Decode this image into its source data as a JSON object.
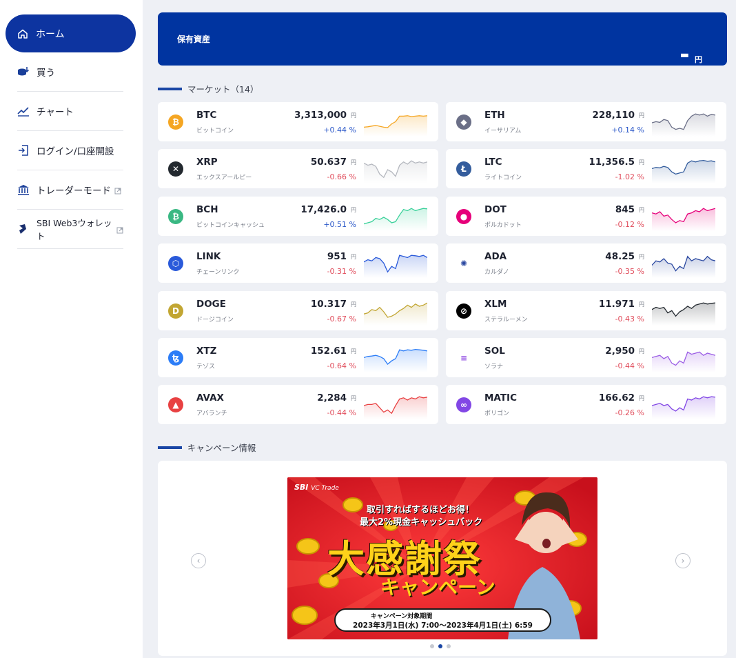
{
  "sidebar": {
    "home": "ホーム",
    "items": [
      {
        "label": "買う",
        "icon": "coins-buy-icon"
      },
      {
        "label": "チャート",
        "icon": "line-chart-icon"
      },
      {
        "label": "ログイン/口座開設",
        "icon": "login-icon"
      },
      {
        "label": "トレーダーモード",
        "icon": "bank-icon",
        "external": true
      },
      {
        "label": "SBI Web3ウォレット",
        "icon": "wallet-icon",
        "external": true
      }
    ]
  },
  "assets": {
    "label": "保有資産",
    "value": "ー",
    "unit": "円"
  },
  "market": {
    "title": "マーケット（14）",
    "coins": [
      {
        "symbol": "BTC",
        "name": "ビットコイン",
        "price": "3,313,000",
        "change": "+0.44 %",
        "dir": "up",
        "color": "#f5a623",
        "glyph": "₿"
      },
      {
        "symbol": "ETH",
        "name": "イーサリアム",
        "price": "228,110",
        "change": "+0.14 %",
        "dir": "up",
        "color": "#6b6f87",
        "glyph": "◆"
      },
      {
        "symbol": "XRP",
        "name": "エックスアールピー",
        "price": "50.637",
        "change": "-0.66 %",
        "dir": "down",
        "color": "#23292f",
        "glyph": "✕"
      },
      {
        "symbol": "LTC",
        "name": "ライトコイン",
        "price": "11,356.5",
        "change": "-1.02 %",
        "dir": "down",
        "color": "#345d9d",
        "glyph": "Ł"
      },
      {
        "symbol": "BCH",
        "name": "ビットコインキャッシュ",
        "price": "17,426.0",
        "change": "+0.51 %",
        "dir": "up",
        "color": "#3ab883",
        "glyph": "₿"
      },
      {
        "symbol": "DOT",
        "name": "ポルカドット",
        "price": "845",
        "change": "-0.12 %",
        "dir": "down",
        "color": "#e6007a",
        "glyph": "●"
      },
      {
        "symbol": "LINK",
        "name": "チェーンリンク",
        "price": "951",
        "change": "-0.31 %",
        "dir": "down",
        "color": "#2a5ada",
        "glyph": "⬡"
      },
      {
        "symbol": "ADA",
        "name": "カルダノ",
        "price": "48.25",
        "change": "-0.35 %",
        "dir": "down",
        "color": "#ffffff",
        "glyph": "✺"
      },
      {
        "symbol": "DOGE",
        "name": "ドージコイン",
        "price": "10.317",
        "change": "-0.67 %",
        "dir": "down",
        "color": "#c2a633",
        "glyph": "D"
      },
      {
        "symbol": "XLM",
        "name": "ステラルーメン",
        "price": "11.971",
        "change": "-0.43 %",
        "dir": "down",
        "color": "#000000",
        "glyph": "⊘"
      },
      {
        "symbol": "XTZ",
        "name": "テゾス",
        "price": "152.61",
        "change": "-0.64 %",
        "dir": "down",
        "color": "#2c7df7",
        "glyph": "ꜩ"
      },
      {
        "symbol": "SOL",
        "name": "ソラナ",
        "price": "2,950",
        "change": "-0.44 %",
        "dir": "down",
        "color": "#ffffff",
        "glyph": "≡"
      },
      {
        "symbol": "AVAX",
        "name": "アバランチ",
        "price": "2,284",
        "change": "-0.44 %",
        "dir": "down",
        "color": "#e84142",
        "glyph": "▲"
      },
      {
        "symbol": "MATIC",
        "name": "ポリゴン",
        "price": "166.62",
        "change": "-0.26 %",
        "dir": "down",
        "color": "#8247e5",
        "glyph": "∞"
      }
    ],
    "price_unit": "円",
    "spark_colors": [
      "#f5a623",
      "#6b6f87",
      "#b5b8bf",
      "#345d9d",
      "#3ad19a",
      "#e6007a",
      "#2a5ada",
      "#2a48a0",
      "#c2a633",
      "#23292f",
      "#2c7df7",
      "#9b5de5",
      "#e84142",
      "#8247e5"
    ]
  },
  "campaign": {
    "title": "キャンペーン情報",
    "brand": "SBI",
    "brand_sub": "VC Trade",
    "line1": "取引すればするほどお得！",
    "line2": "最大2%現金キャッシュバック",
    "headline": "大感謝祭",
    "sub": "キャンペーン",
    "period_label": "キャンペーン対象期間",
    "period": "2023年3月1日(水) 7:00〜2023年4月1日(土) 6:59",
    "prev": "‹",
    "next": "›"
  }
}
